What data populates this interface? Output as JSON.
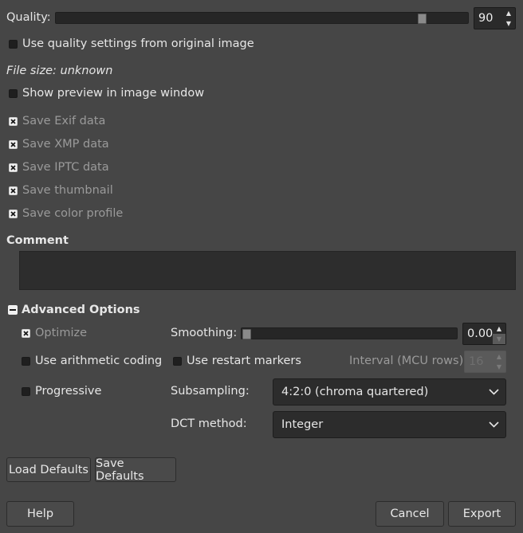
{
  "quality": {
    "label": "Quality:",
    "value": "90",
    "fraction": 0.9
  },
  "use_quality_original": {
    "label": "Use quality settings from original image",
    "checked": false
  },
  "file_size": "File size: unknown",
  "show_preview": {
    "label": "Show preview in image window",
    "checked": false
  },
  "metadata": [
    {
      "label": "Save Exif data",
      "checked": true
    },
    {
      "label": "Save XMP data",
      "checked": true
    },
    {
      "label": "Save IPTC data",
      "checked": true
    },
    {
      "label": "Save thumbnail",
      "checked": true
    },
    {
      "label": "Save color profile",
      "checked": true
    }
  ],
  "comment": {
    "label": "Comment",
    "value": ""
  },
  "advanced": {
    "label": "Advanced Options",
    "optimize": {
      "label": "Optimize",
      "checked": true
    },
    "arithmetic": {
      "label": "Use arithmetic coding",
      "checked": false
    },
    "progressive": {
      "label": "Progressive",
      "checked": false
    },
    "smoothing": {
      "label": "Smoothing:",
      "value": "0.00",
      "fraction": 0.0
    },
    "restart_markers": {
      "label": "Use restart markers",
      "checked": false
    },
    "interval": {
      "label": "Interval (MCU rows):",
      "value": "16"
    },
    "subsampling": {
      "label": "Subsampling:",
      "value": "4:2:0 (chroma quartered)"
    },
    "dct": {
      "label": "DCT method:",
      "value": "Integer"
    }
  },
  "buttons": {
    "load_defaults": "Load Defaults",
    "save_defaults": "Save Defaults",
    "help": "Help",
    "cancel": "Cancel",
    "export": "Export"
  }
}
